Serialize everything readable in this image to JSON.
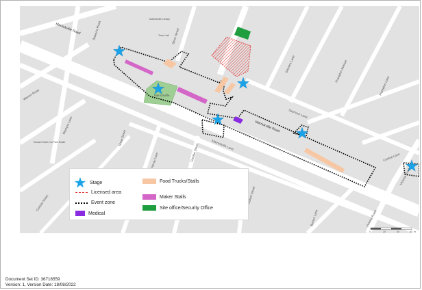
{
  "streets": {
    "marrickville_road": "Marrickville Road",
    "illawarra_road": "Illawarra Road",
    "warren_road": "Warren Road",
    "silver_street": "Silver Street",
    "seymour_lane": "Seymour Lane",
    "garners_lane": "Garners Lane",
    "frampton_avenue": "Frampton Avenue",
    "frampton_lane": "Frampton Lane",
    "central_lane": "Central Lane",
    "victoria_road": "Victoria Road",
    "marrickville_lane": "Marrickville Lane",
    "wemyss_lane": "Wemyss Lane",
    "shaw_street": "Shaw Street",
    "central_street": "Central Street",
    "fitzroy_lane": "Fitzroy Lane",
    "gordon_street": "Gordon Street",
    "byrnes_lane": "Byrnes Lane",
    "station_street": "Station Street"
  },
  "places": {
    "marrickville_park": "Marrickville",
    "library": "Marrickville Library",
    "town_hall": "Town Hall",
    "car_park": "Edward Street Car Park Estate"
  },
  "legend": {
    "stage": "Stage",
    "licensed_area": "Licensed area",
    "event_zone": "Event zone",
    "medical": "Medical",
    "food_trucks": "Food Trucks/Stalls",
    "maker_stalls": "Maker Stalls",
    "site_office": "Site office/Security Office"
  },
  "scale_bar": {
    "ticks": [
      "0",
      "20",
      "40",
      "60"
    ],
    "unit": "m"
  },
  "colors": {
    "stage": "#1aa3e8",
    "licensed_area": "#e03030",
    "event_zone": "#000000",
    "medical": "#8a2be2",
    "food_trucks": "#f7c7a3",
    "maker_stalls": "#d466c8",
    "site_office": "#1e9e3e",
    "park": "#9fcf94",
    "road": "#ffffff",
    "block": "#e2e2e2"
  },
  "document": {
    "set_id_line": "Document Set ID: 36716559",
    "version_line": "Version: 1, Version Date: 18/08/2022"
  }
}
